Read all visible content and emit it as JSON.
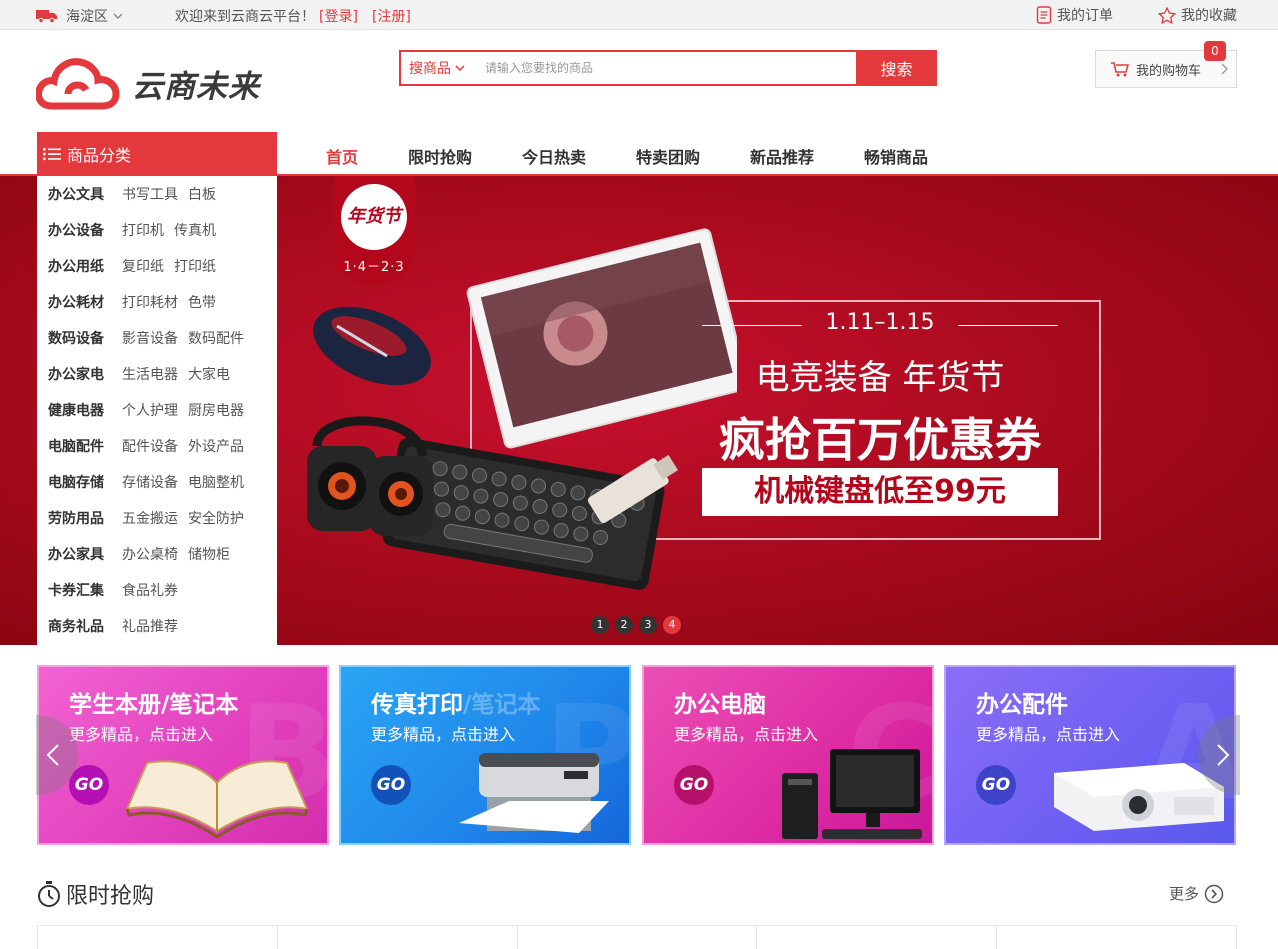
{
  "topbar": {
    "location": "海淀区",
    "welcome": "欢迎来到云商云平台！",
    "login": "[登录]",
    "register": "[注册]",
    "my_orders": "我的订单",
    "my_favorites": "我的收藏"
  },
  "header": {
    "logo_text": "云商未来",
    "search_category": "搜商品",
    "search_placeholder": "请输入您要找的商品",
    "search_button": "搜索",
    "cart_label": "我的购物车",
    "cart_count": "0"
  },
  "nav": {
    "category_title": "商品分类",
    "links": [
      "首页",
      "限时抢购",
      "今日热卖",
      "特卖团购",
      "新品推荐",
      "畅销商品"
    ]
  },
  "sidebar": {
    "items": [
      {
        "main": "办公文具",
        "subs": [
          "书写工具",
          "白板"
        ]
      },
      {
        "main": "办公设备",
        "subs": [
          "打印机",
          "传真机"
        ]
      },
      {
        "main": "办公用纸",
        "subs": [
          "复印纸",
          "打印纸"
        ]
      },
      {
        "main": "办公耗材",
        "subs": [
          "打印耗材",
          "色带"
        ]
      },
      {
        "main": "数码设备",
        "subs": [
          "影音设备",
          "数码配件"
        ]
      },
      {
        "main": "办公家电",
        "subs": [
          "生活电器",
          "大家电"
        ]
      },
      {
        "main": "健康电器",
        "subs": [
          "个人护理",
          "厨房电器"
        ]
      },
      {
        "main": "电脑配件",
        "subs": [
          "配件设备",
          "外设产品"
        ]
      },
      {
        "main": "电脑存储",
        "subs": [
          "存储设备",
          "电脑整机"
        ]
      },
      {
        "main": "劳防用品",
        "subs": [
          "五金搬运",
          "安全防护"
        ]
      },
      {
        "main": "办公家具",
        "subs": [
          "办公桌椅",
          "储物柜"
        ]
      },
      {
        "main": "卡券汇集",
        "subs": [
          "食品礼券"
        ]
      },
      {
        "main": "商务礼品",
        "subs": [
          "礼品推荐"
        ]
      }
    ]
  },
  "banner": {
    "tag_text": "年货节",
    "tag_date": "1·4－2·3",
    "date": "1.11–1.15",
    "title": "电竞装备 年货节",
    "headline": "疯抢百万优惠券",
    "subline": "机械键盘低至99元",
    "dots": [
      "1",
      "2",
      "3",
      "4"
    ],
    "active_dot": 3
  },
  "cards": [
    {
      "title": "学生本册/笔记本",
      "sub": "更多精品，点击进入",
      "go": "GO",
      "ghost": "B"
    },
    {
      "title": "传真打印",
      "title_ghost": "/笔记本",
      "sub": "更多精品，点击进入",
      "go": "GO",
      "ghost": "P"
    },
    {
      "title": "办公电脑",
      "sub": "更多精品，点击进入",
      "go": "GO",
      "ghost": "C"
    },
    {
      "title": "办公配件",
      "sub": "更多精品，点击进入",
      "go": "GO",
      "ghost": "A"
    }
  ],
  "section": {
    "title": "限时抢购",
    "more": "更多"
  },
  "colors": {
    "brand": "#e4393c",
    "banner": "#a50a1c"
  }
}
